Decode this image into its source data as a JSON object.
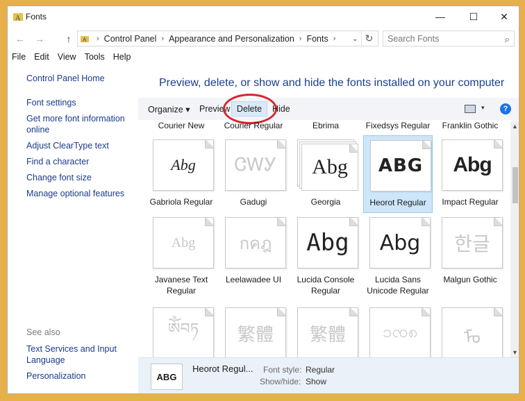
{
  "window": {
    "title": "Fonts",
    "minimize": "—",
    "maximize": "☐",
    "close": "✕"
  },
  "address": {
    "back": "←",
    "forward": "→",
    "up": "↑",
    "path": [
      "Control Panel",
      "Appearance and Personalization",
      "Fonts"
    ],
    "refresh": "↻",
    "search_placeholder": "Search Fonts"
  },
  "menu": [
    "File",
    "Edit",
    "View",
    "Tools",
    "Help"
  ],
  "sidebar": {
    "home": "Control Panel Home",
    "links": [
      "Font settings",
      "Get more font information online",
      "Adjust ClearType text",
      "Find a character",
      "Change font size",
      "Manage optional features"
    ],
    "see_also_title": "See also",
    "see_also": [
      "Text Services and Input Language",
      "Personalization"
    ]
  },
  "main": {
    "headline": "Preview, delete, or show and hide the fonts installed on your computer",
    "toolbar": {
      "organize": "Organize ▾",
      "preview": "Preview",
      "delete": "Delete",
      "hide": "Hide",
      "help": "?"
    },
    "top_row_labels": [
      "Courier New",
      "Courier Regular",
      "Ebrima",
      "Fixedsys Regular",
      "Franklin Gothic"
    ],
    "rows": [
      [
        {
          "name": "Gabriola Regular",
          "sample": "Abg"
        },
        {
          "name": "Gadugi",
          "sample": "ᏣᎳᎩ"
        },
        {
          "name": "Georgia",
          "sample": "Abg"
        },
        {
          "name": "Heorot Regular",
          "sample": "ABG"
        },
        {
          "name": "Impact Regular",
          "sample": "Abg"
        }
      ],
      [
        {
          "name": "Javanese Text Regular",
          "sample": "Abg"
        },
        {
          "name": "Leelawadee UI",
          "sample": "กคฎ"
        },
        {
          "name": "Lucida Console Regular",
          "sample": "Abg"
        },
        {
          "name": "Lucida Sans Unicode Regular",
          "sample": "Abg"
        },
        {
          "name": "Malgun Gothic",
          "sample": "한글"
        }
      ],
      [
        {
          "name": "",
          "sample": "ༀབཏ"
        },
        {
          "name": "",
          "sample": "繁體"
        },
        {
          "name": "",
          "sample": "繁體"
        },
        {
          "name": "",
          "sample": "ၥၸ၈"
        },
        {
          "name": "",
          "sample": "ᠮᠣ"
        }
      ]
    ],
    "selected_index": 3
  },
  "details": {
    "thumb": "ABG",
    "name": "Heorot Regul...",
    "style_label": "Font style:",
    "style_value": "Regular",
    "show_label": "Show/hide:",
    "show_value": "Show"
  },
  "colors": {
    "accent": "#1a3f8c",
    "selection": "#cde6fa",
    "annotation": "#d6262e"
  }
}
